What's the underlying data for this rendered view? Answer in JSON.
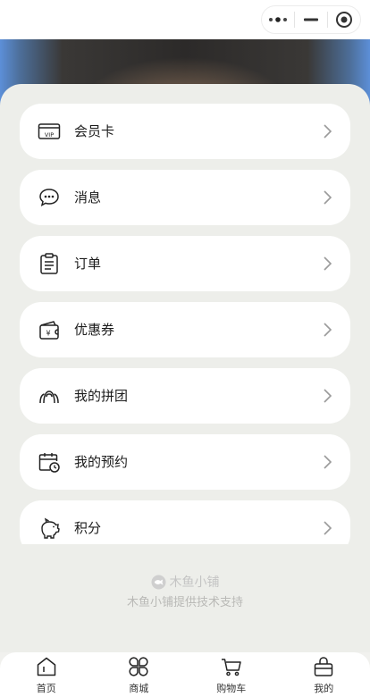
{
  "menu": {
    "items": [
      {
        "label": "会员卡",
        "icon": "vip-card-icon"
      },
      {
        "label": "消息",
        "icon": "message-icon"
      },
      {
        "label": "订单",
        "icon": "order-clipboard-icon"
      },
      {
        "label": "优惠券",
        "icon": "coupon-wallet-icon"
      },
      {
        "label": "我的拼团",
        "icon": "group-buy-icon"
      },
      {
        "label": "我的预约",
        "icon": "calendar-clock-icon"
      },
      {
        "label": "积分",
        "icon": "piggy-bank-icon"
      }
    ]
  },
  "footer": {
    "brand": "木鱼小铺",
    "tagline": "木鱼小铺提供技术支持"
  },
  "tabbar": {
    "tabs": [
      {
        "label": "首页",
        "icon": "home-icon"
      },
      {
        "label": "商城",
        "icon": "mall-icon"
      },
      {
        "label": "购物车",
        "icon": "cart-icon"
      },
      {
        "label": "我的",
        "icon": "profile-bag-icon"
      }
    ]
  },
  "colors": {
    "page_bg": "#f1f1ee",
    "card_bg": "#ffffff",
    "footer_text": "#b9b9b6"
  }
}
